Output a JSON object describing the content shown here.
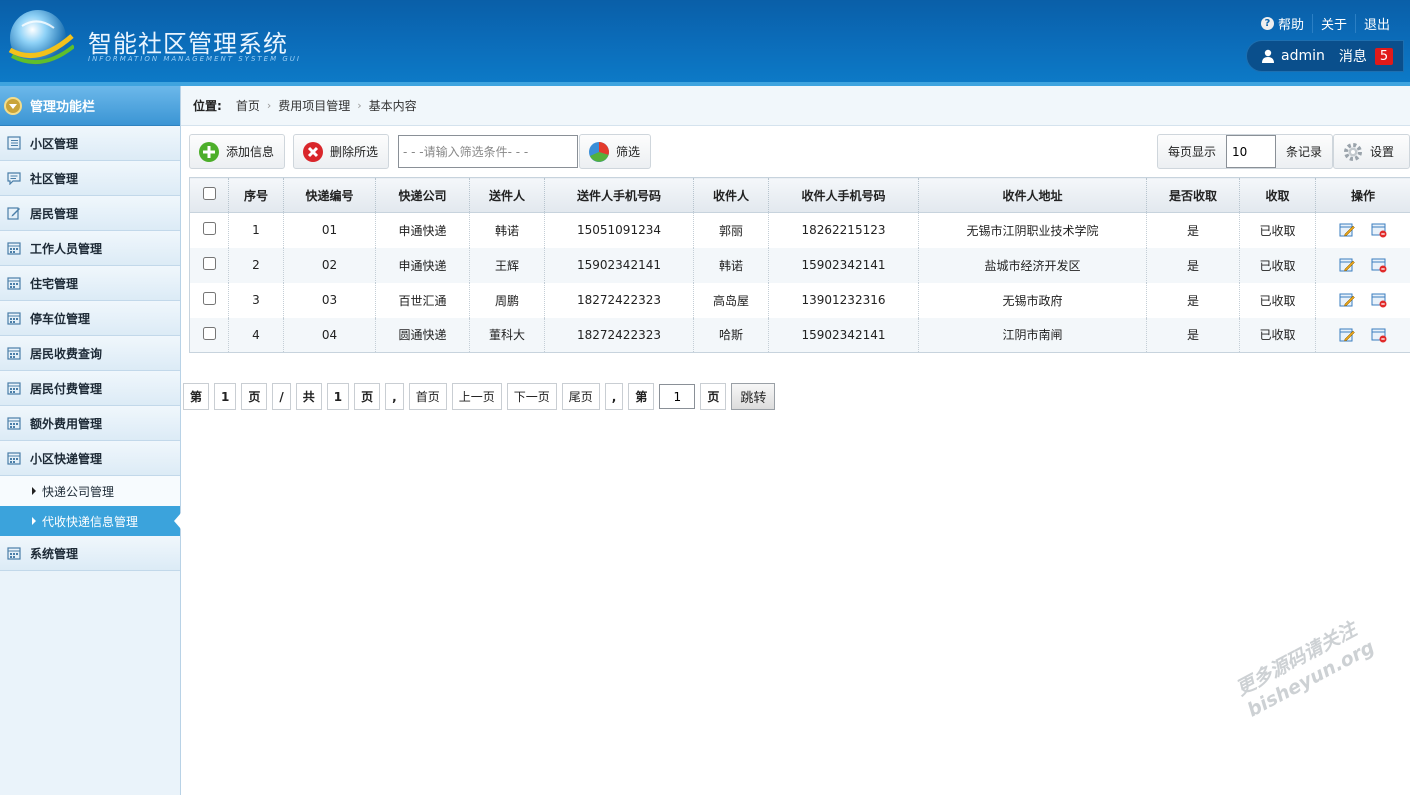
{
  "header": {
    "title": "智能社区管理系统",
    "subtitle": "INFORMATION MANAGEMENT SYSTEM GUI",
    "links": [
      "帮助",
      "关于",
      "退出"
    ],
    "username": "admin",
    "message_label": "消息",
    "message_count": "5"
  },
  "sidebar": {
    "heading": "管理功能栏",
    "items": [
      {
        "label": "小区管理",
        "icon": "list-icon"
      },
      {
        "label": "社区管理",
        "icon": "chat-icon"
      },
      {
        "label": "居民管理",
        "icon": "edit-icon"
      },
      {
        "label": "工作人员管理",
        "icon": "calendar-icon"
      },
      {
        "label": "住宅管理",
        "icon": "calendar-icon"
      },
      {
        "label": "停车位管理",
        "icon": "calendar-icon"
      },
      {
        "label": "居民收费查询",
        "icon": "calendar-icon"
      },
      {
        "label": "居民付费管理",
        "icon": "calendar-icon"
      },
      {
        "label": "额外费用管理",
        "icon": "calendar-icon"
      },
      {
        "label": "小区快递管理",
        "icon": "calendar-icon"
      }
    ],
    "sub_items": [
      "快递公司管理",
      "代收快递信息管理"
    ],
    "last_item": "系统管理"
  },
  "breadcrumb": {
    "label": "位置:",
    "items": [
      "首页",
      "费用项目管理",
      "基本内容"
    ]
  },
  "toolbar": {
    "add_label": "添加信息",
    "delete_label": "删除所选",
    "filter_placeholder": "- - -请输入筛选条件- - -",
    "filter_label": "筛选",
    "per_page_label": "每页显示",
    "per_page_value": "10",
    "records_label": "条记录",
    "settings_label": "设置"
  },
  "table": {
    "columns": [
      "序号",
      "快递编号",
      "快递公司",
      "送件人",
      "送件人手机号码",
      "收件人",
      "收件人手机号码",
      "收件人地址",
      "是否收取",
      "收取",
      "操作"
    ],
    "rows": [
      [
        "1",
        "01",
        "申通快递",
        "韩诺",
        "15051091234",
        "郭丽",
        "18262215123",
        "无锡市江阴职业技术学院",
        "是",
        "已收取"
      ],
      [
        "2",
        "02",
        "申通快递",
        "王辉",
        "15902342141",
        "韩诺",
        "15902342141",
        "盐城市经济开发区",
        "是",
        "已收取"
      ],
      [
        "3",
        "03",
        "百世汇通",
        "周鹏",
        "18272422323",
        "高岛屋",
        "13901232316",
        "无锡市政府",
        "是",
        "已收取"
      ],
      [
        "4",
        "04",
        "圆通快递",
        "董科大",
        "18272422323",
        "哈斯",
        "15902342141",
        "江阴市南闸",
        "是",
        "已收取"
      ]
    ]
  },
  "pager": {
    "di": "第",
    "current": "1",
    "ye": "页",
    "slash": "/",
    "gong": "共",
    "total": "1",
    "ye2": "页",
    "comma": ",",
    "first": "首页",
    "prev": "上一页",
    "next": "下一页",
    "last": "尾页",
    "comma2": ",",
    "di2": "第",
    "jump_value": "1",
    "ye3": "页",
    "go": "跳转"
  },
  "watermark": {
    "line1": "更多源码请关注",
    "line2": "bisheyun.org"
  },
  "colors": {
    "header": "#0b6bb8",
    "active": "#3ba3dc",
    "badge": "#e01a1a"
  }
}
